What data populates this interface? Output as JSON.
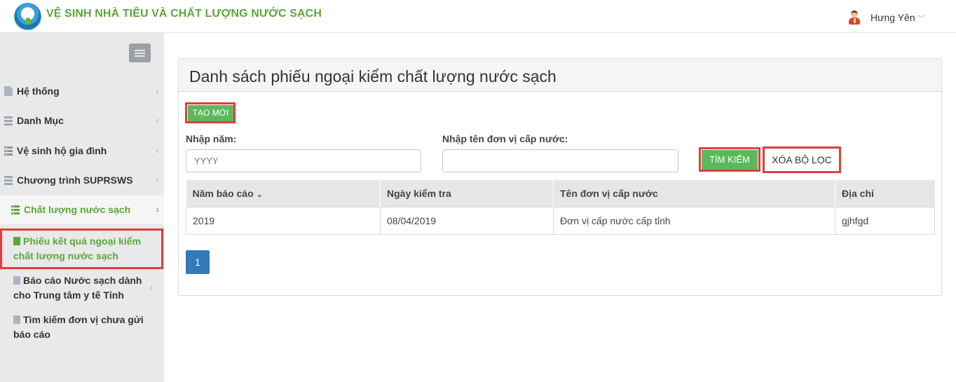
{
  "header": {
    "app_title": "VỆ SINH NHÀ TIÊU VÀ CHẤT LƯỢNG NƯỚC SẠCH",
    "user_name": "Hưng Yên",
    "user_caret": "﹀"
  },
  "sidebar": {
    "items": [
      {
        "label": "Hệ thống",
        "icon": "document-icon"
      },
      {
        "label": "Danh Mục",
        "icon": "list-icon"
      },
      {
        "label": "Vệ sinh hộ gia đình",
        "icon": "server-icon"
      },
      {
        "label": "Chương trình SUPRSWS",
        "icon": "list-icon"
      },
      {
        "label": "Chất lượng nước sạch",
        "icon": "server-icon"
      }
    ],
    "subitems": [
      {
        "label_line1": "Phiếu kết quả ngoại kiểm",
        "label_line2": "chất lượng nước sạch"
      },
      {
        "label_line1": "Báo cáo Nước sạch dành",
        "label_line2": "cho Trung tâm y tế Tỉnh"
      },
      {
        "label_line1": "Tìm kiếm đơn vị chưa gửi",
        "label_line2": "báo cáo"
      }
    ],
    "chevron": "‹"
  },
  "main": {
    "title": "Danh sách phiếu ngoại kiểm chất lượng nước sạch",
    "create_button": "TẠO MỚI",
    "year_label": "Nhập năm:",
    "year_placeholder": "YYYY",
    "unit_label": "Nhập tên đơn vị cấp nước:",
    "unit_value": "",
    "search_button": "TÌM KIẾM",
    "clear_button": "XÓA BỘ LỌC",
    "table": {
      "headers": [
        "Năm báo cáo",
        "Ngày kiểm tra",
        "Tên đơn vị cấp nước",
        "Địa chỉ"
      ],
      "sort_icon": "⌄",
      "rows": [
        [
          "2019",
          "08/04/2019",
          "Đơn vị cấp nước cấp tỉnh",
          "gjhfgd"
        ]
      ]
    },
    "pagination": {
      "current_page": "1"
    }
  },
  "colors": {
    "accent_green": "#5aa83a",
    "button_green": "#5cb85c",
    "highlight_red": "#e23d3d",
    "page_blue": "#337ab7"
  }
}
